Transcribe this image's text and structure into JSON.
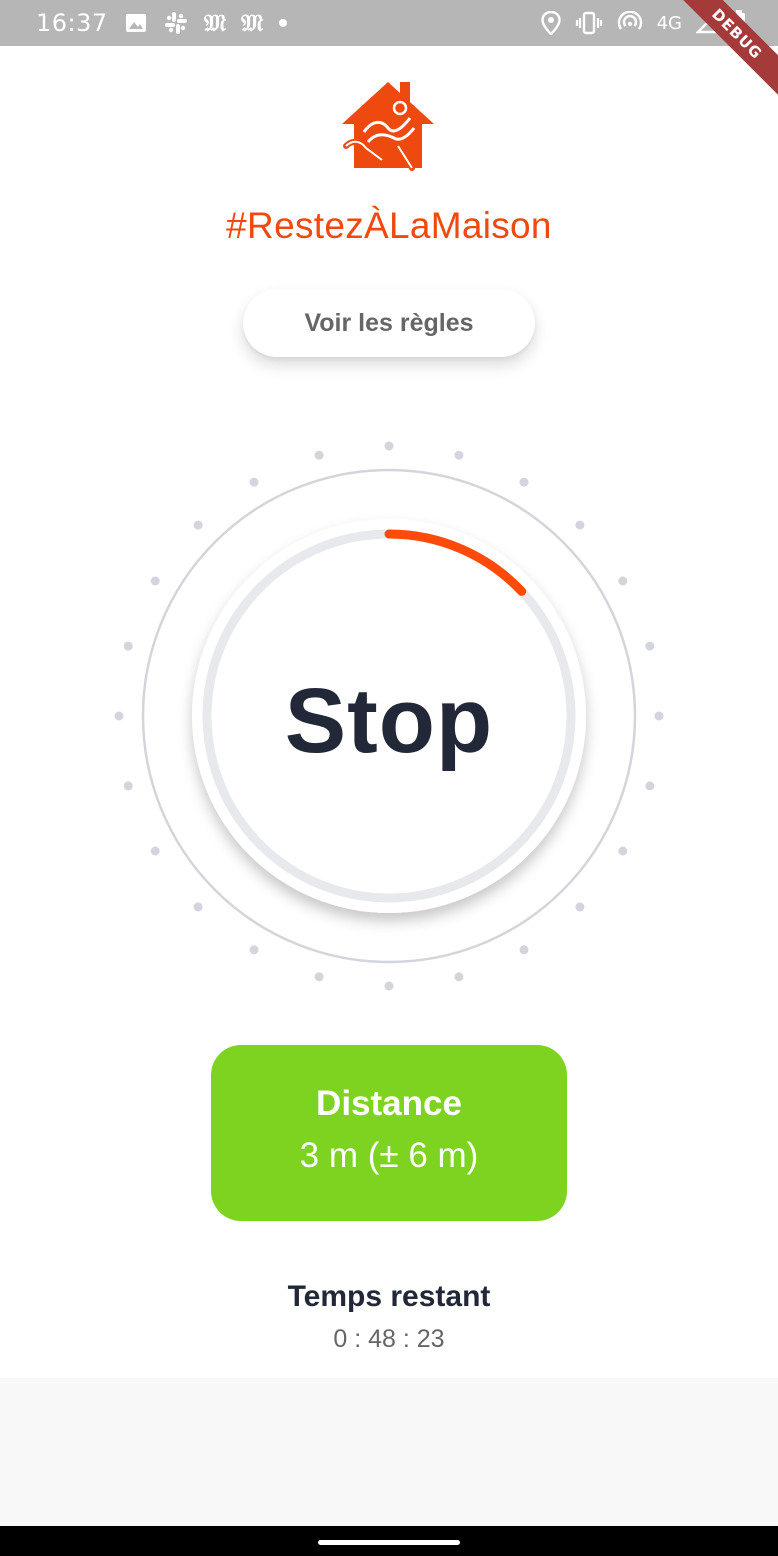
{
  "status_bar": {
    "time": "16:37",
    "left_icons": [
      "image-icon",
      "slack-icon",
      "le-monde-icon",
      "le-monde-icon",
      "dot-icon"
    ],
    "nyt_glyph": "𝔐",
    "network": "4G",
    "right_icons": [
      "location-icon",
      "vibrate-icon",
      "hotspot-icon",
      "signal-icon",
      "battery-icon"
    ]
  },
  "debug_banner": "DEBUG",
  "header": {
    "hashtag": "#RestezÀLaMaison",
    "rules_button": "Voir les règles"
  },
  "dial": {
    "button_label": "Stop",
    "progress": 0.13,
    "colors": {
      "progress": "#ff4a0a",
      "track": "#e8e9ec",
      "ring": "#d4d5dc",
      "dots": "#d4d5dc"
    }
  },
  "distance": {
    "title": "Distance",
    "value": "3 m (± 6 m)",
    "color": "#7ed321"
  },
  "remaining": {
    "title": "Temps restant",
    "value": "0 : 48 : 23"
  },
  "colors": {
    "accent": "#ee4a0f",
    "text_dark": "#222838",
    "text_grey": "#666666"
  }
}
